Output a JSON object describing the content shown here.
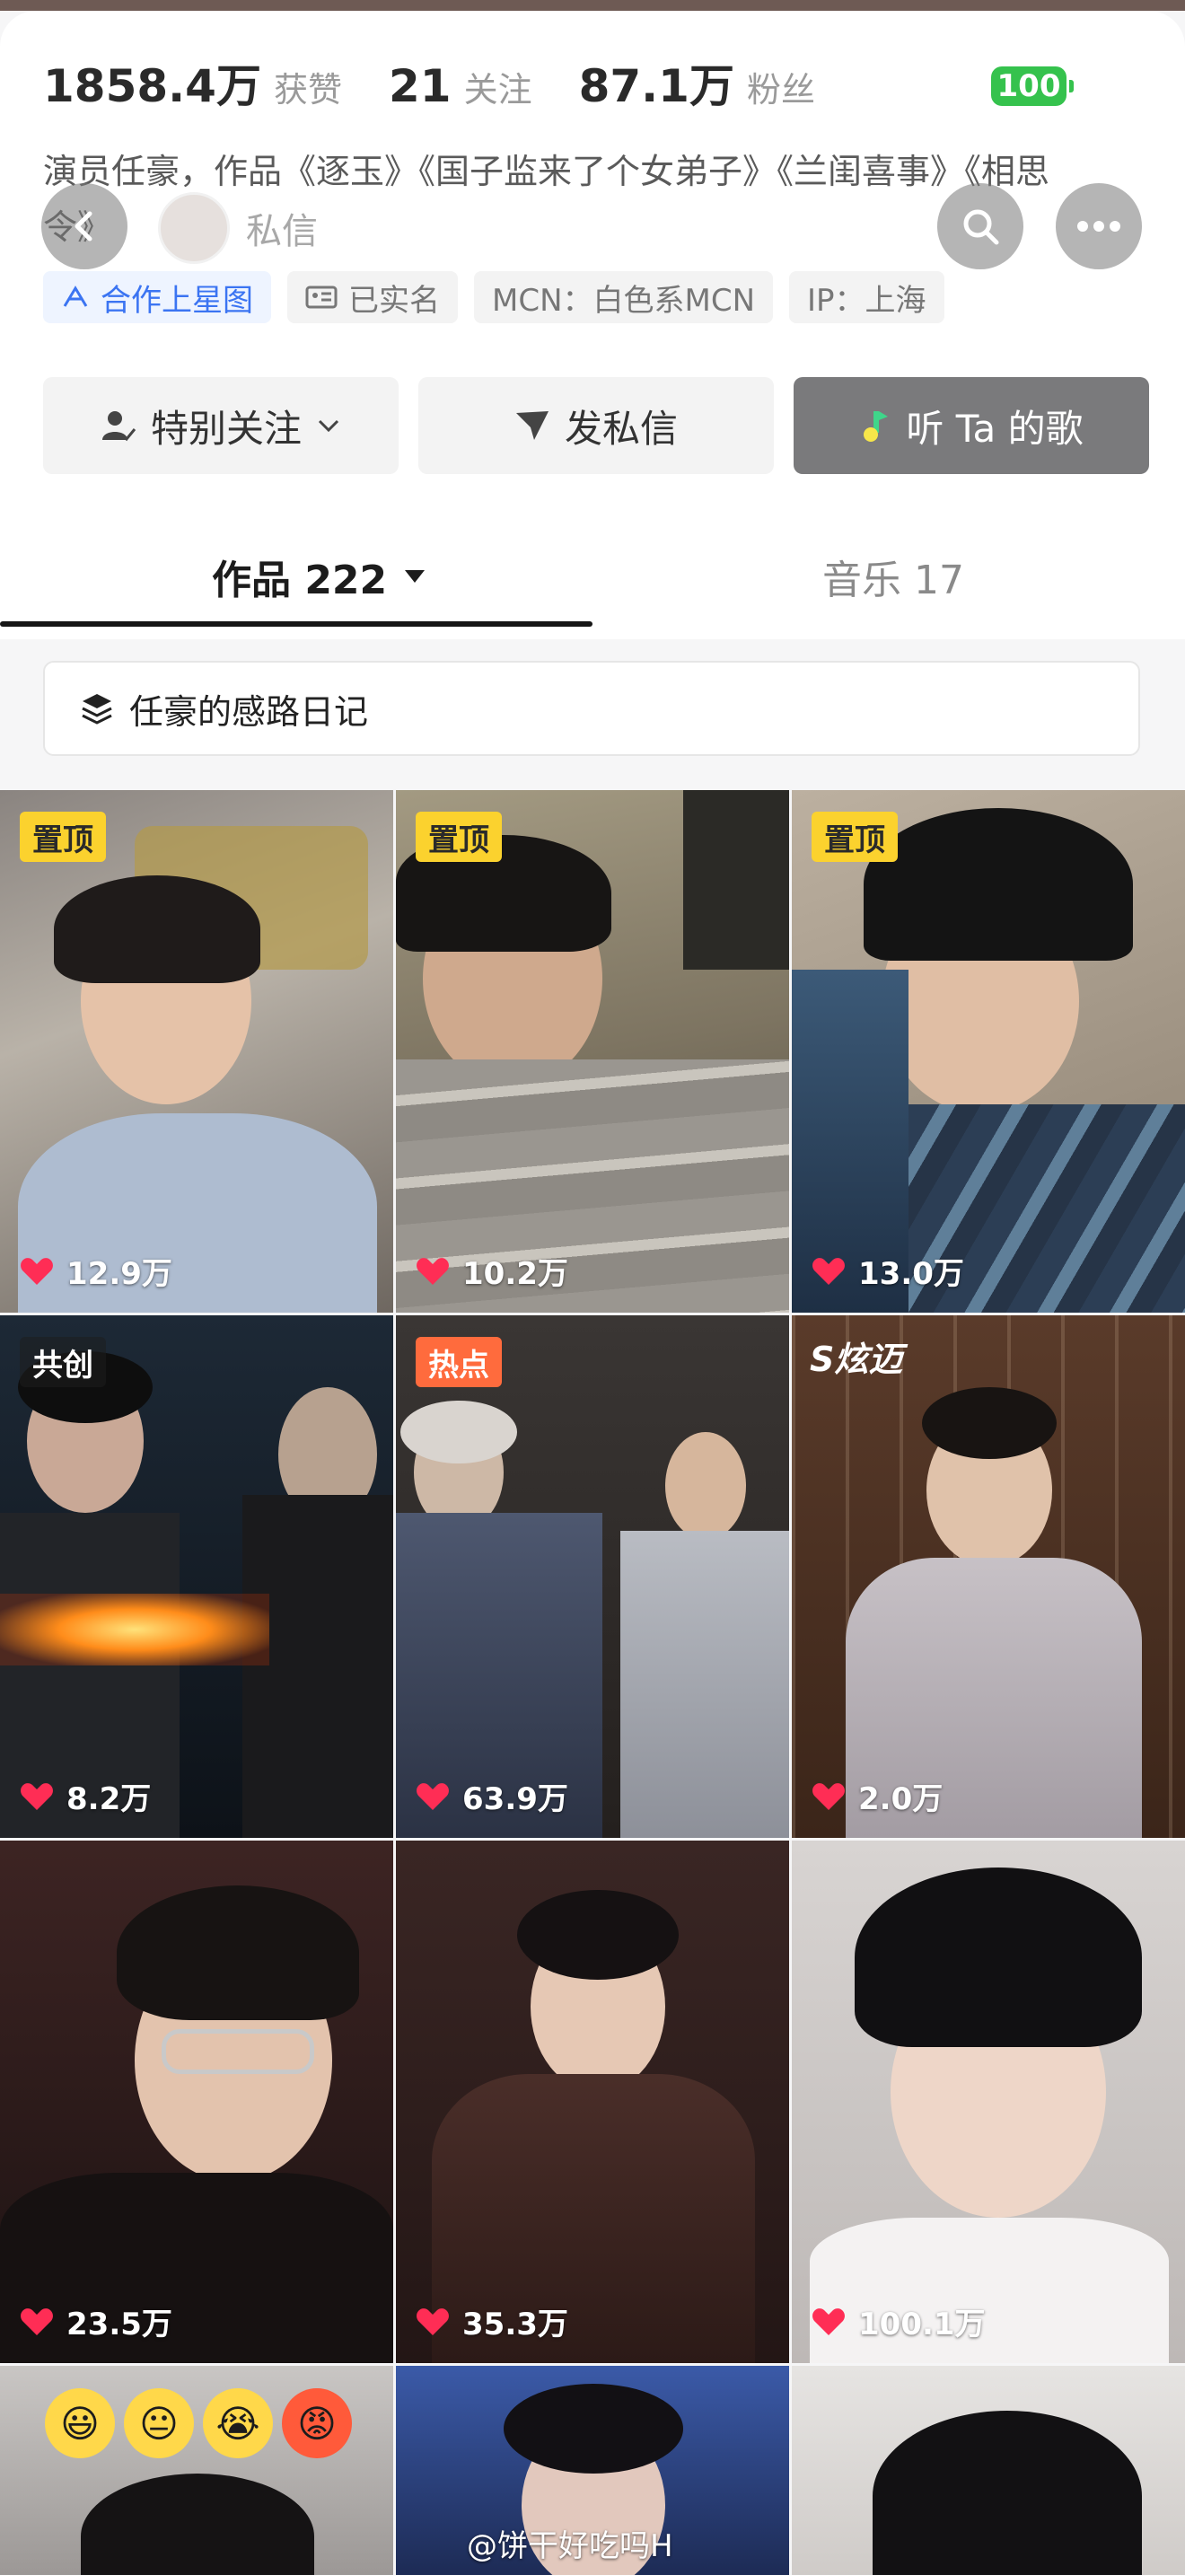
{
  "stats": {
    "likes_num": "1858.4万",
    "likes_label": "获赞",
    "following_num": "21",
    "following_label": "关注",
    "fans_num": "87.1万",
    "fans_label": "粉丝"
  },
  "battery": "100",
  "bio": "演员任豪，作品《逐玉》《国子监来了个女弟子》《兰闺喜事》《相思",
  "bio_cont": "令》",
  "private_message": "私信",
  "tags": {
    "star": "合作上星图",
    "verified": "已实名",
    "mcn": "MCN：白色系MCN",
    "ip": "IP：上海"
  },
  "actions": {
    "follow": "特别关注",
    "message": "发私信",
    "songs": "听 Ta 的歌"
  },
  "tabs": {
    "works": "作品 222",
    "music": "音乐 17"
  },
  "collection": "任豪的感路日记",
  "videos": [
    {
      "badge": "置顶",
      "likes": "12.9万"
    },
    {
      "badge": "置顶",
      "likes": "10.2万"
    },
    {
      "badge": "置顶",
      "likes": "13.0万"
    },
    {
      "badge": "共创",
      "likes": "8.2万"
    },
    {
      "badge": "热点",
      "likes": "63.9万"
    },
    {
      "badge": "",
      "likes": "2.0万"
    },
    {
      "badge": "",
      "likes": "23.5万"
    },
    {
      "badge": "",
      "likes": "35.3万"
    },
    {
      "badge": "",
      "likes": "100.1万"
    }
  ],
  "overlay_text": "S炫迈",
  "emojis": [
    "😃",
    "😐",
    "😭",
    "😡"
  ],
  "watermark": "@饼干好吃吗H",
  "colors": {
    "accent_blue": "#3b74f2",
    "pin_yellow": "#fbd22e",
    "hot_orange": "#ff6b3d",
    "heart": "#ff2d55"
  }
}
